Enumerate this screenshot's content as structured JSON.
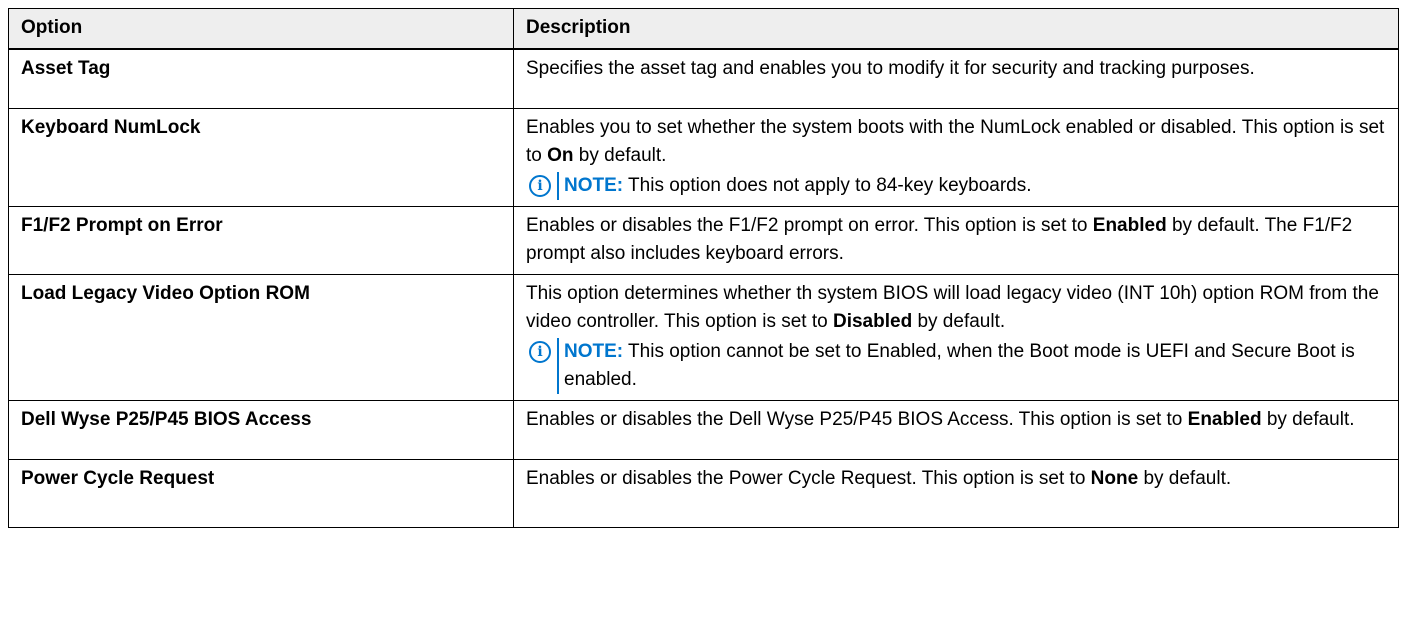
{
  "table": {
    "headers": [
      "Option",
      "Description"
    ],
    "rows": [
      {
        "option": "Asset Tag",
        "description": [
          {
            "text": "Specifies the asset tag and enables you to modify it for security and tracking purposes."
          }
        ]
      },
      {
        "option": "Keyboard NumLock",
        "description": [
          {
            "text": "Enables you to set whether the system boots with the NumLock enabled or disabled. This option is set to "
          },
          {
            "bold": "On"
          },
          {
            "text": " by default."
          }
        ],
        "note": {
          "label": "NOTE:",
          "text": " This option does not apply to 84-key keyboards."
        }
      },
      {
        "option": "F1/F2 Prompt on Error",
        "description": [
          {
            "text": "Enables or disables the F1/F2 prompt on error. This option is set to "
          },
          {
            "bold": "Enabled"
          },
          {
            "text": " by default. The F1/F2 prompt also includes keyboard errors."
          }
        ]
      },
      {
        "option": "Load Legacy Video Option ROM",
        "description": [
          {
            "text": "This option determines whether th system BIOS will load legacy video (INT 10h) option ROM from the video controller. This option is set to "
          },
          {
            "bold": "Disabled"
          },
          {
            "text": " by default."
          }
        ],
        "note": {
          "label": "NOTE:",
          "text": " This option cannot be set to Enabled, when the Boot mode is UEFI and Secure Boot is enabled."
        }
      },
      {
        "option": "Dell Wyse P25/P45 BIOS Access",
        "description": [
          {
            "text": "Enables or disables the Dell Wyse P25/P45 BIOS Access. This option is set to "
          },
          {
            "bold": "Enabled"
          },
          {
            "text": " by default."
          }
        ]
      },
      {
        "option": "Power Cycle Request",
        "description": [
          {
            "text": "Enables or disables the Power Cycle Request. This option is set to "
          },
          {
            "bold": "None"
          },
          {
            "text": " by default."
          }
        ]
      }
    ]
  },
  "note_icon": "info-circle-icon",
  "colors": {
    "note_accent": "#0076ce",
    "header_bg": "#eeeeee",
    "border": "#000000"
  }
}
